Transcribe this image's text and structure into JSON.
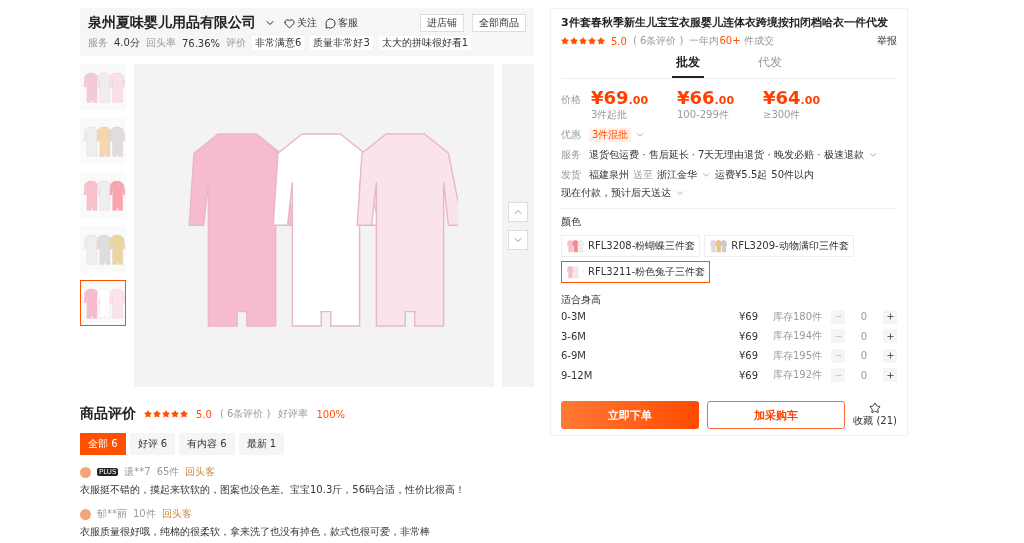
{
  "store": {
    "name": "泉州夏味婴儿用品有限公司",
    "follow": "关注",
    "service": "客服",
    "buttons": [
      "进店铺",
      "全部商品"
    ],
    "stats": [
      {
        "label": "服务",
        "value": "4.0分"
      },
      {
        "label": "回头率",
        "value": "76.36%"
      }
    ],
    "rating_label": "评价",
    "tags": [
      "非常满意6",
      "质量非常好3",
      "太大的拼味很好看1"
    ]
  },
  "gallery": {
    "thumbnails": [
      {
        "selected": false
      },
      {
        "selected": false
      },
      {
        "selected": false
      },
      {
        "selected": false
      },
      {
        "selected": true
      }
    ]
  },
  "reviews": {
    "title": "商品评价",
    "stars": 5,
    "score": "5.0",
    "count": "( 6条评价 )",
    "rate_label": "好评率",
    "rate": "100%",
    "filters": [
      {
        "label": "全部 6",
        "selected": true
      },
      {
        "label": "好评 6",
        "selected": false
      },
      {
        "label": "有内容 6",
        "selected": false
      },
      {
        "label": "最新 1",
        "selected": false
      }
    ],
    "items": [
      {
        "badge": "PLUS",
        "user": "遗**7",
        "count": "65件",
        "tag": "回头客",
        "text": "衣服挺不错的，摸起来软软的，图案也没色差。宝宝10.3斤，56码合适，性价比很高！"
      },
      {
        "user": "郁**丽",
        "count": "10件",
        "tag": "回头客",
        "text": "衣服质量很好哦，纯棉的很柔软，拿来洗了也没有掉色，款式也很可爱，非常棒"
      }
    ]
  },
  "product": {
    "title": "3件套春秋季新生儿宝宝衣服婴儿连体衣跨境按扣闭档哈衣一件代发",
    "stars": 5,
    "score": "5.0",
    "count": "( 6条评价 )",
    "sales_prefix": "一年内",
    "sales": "60+",
    "sales_suffix": "件成交",
    "report": "举报",
    "modes": [
      {
        "label": "批发",
        "selected": true
      },
      {
        "label": "代发",
        "selected": false
      }
    ],
    "price_label": "价格",
    "prices": [
      {
        "currency": "¥",
        "amount": "69",
        "decimals": ".00",
        "note": "3件起批"
      },
      {
        "currency": "¥",
        "amount": "66",
        "decimals": ".00",
        "note": "100-299件"
      },
      {
        "currency": "¥",
        "amount": "64",
        "decimals": ".00",
        "note": "≥300件"
      }
    ],
    "discount_label": "优惠",
    "discount": "3件混批",
    "service_label": "服务",
    "services": "退货包运费 · 售后延长 · 7天无理由退货 · 晚发必赔 · 极速退款",
    "shipping_label": "发货",
    "ship_from": "福建泉州",
    "ship_word": "送至",
    "ship_to": "浙江金华",
    "fee": "运费¥5.5起",
    "limit": "50件以内",
    "eta": "现在付款，预计后天送达",
    "color_label": "颜色",
    "colors": [
      {
        "label": "RFL3208-粉蝴蝶三件套",
        "selected": false
      },
      {
        "label": "RFL3209-动物满印三件套",
        "selected": false
      },
      {
        "label": "RFL3211-粉色兔子三件套",
        "selected": true
      }
    ],
    "size_label": "适合身高",
    "sizes": [
      {
        "size": "0-3M",
        "price": "¥69",
        "stock": "库存180件",
        "qty": "0"
      },
      {
        "size": "3-6M",
        "price": "¥69",
        "stock": "库存194件",
        "qty": "0"
      },
      {
        "size": "6-9M",
        "price": "¥69",
        "stock": "库存195件",
        "qty": "0"
      },
      {
        "size": "9-12M",
        "price": "¥69",
        "stock": "库存192件",
        "qty": "0"
      }
    ],
    "buy": "立即下单",
    "cart": "加采购车",
    "favorite": "收藏 (21)"
  }
}
